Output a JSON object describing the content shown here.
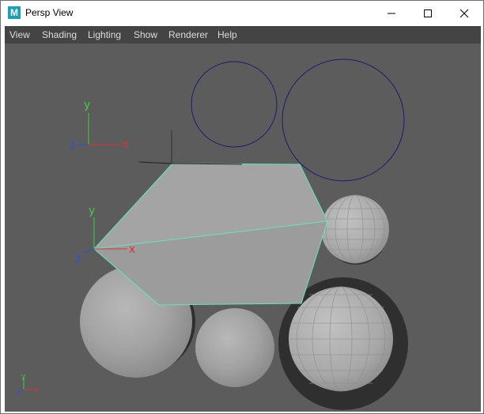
{
  "window": {
    "title": "Persp View",
    "app_icon_letter": "M"
  },
  "menubar": {
    "items": [
      "View",
      "Shading",
      "Lighting",
      "Show",
      "Renderer",
      "Help"
    ]
  },
  "viewport": {
    "axis_labels": {
      "x": "x",
      "y": "y",
      "z": "z"
    }
  },
  "colors": {
    "viewport_bg": "#5c5c5c",
    "menubar_bg": "#444444",
    "selection_highlight": "#5fe8c0",
    "circle_outline": "#1a1a6e",
    "axis_x": "#e03030",
    "axis_y": "#40d040",
    "axis_z": "#3050e0"
  }
}
